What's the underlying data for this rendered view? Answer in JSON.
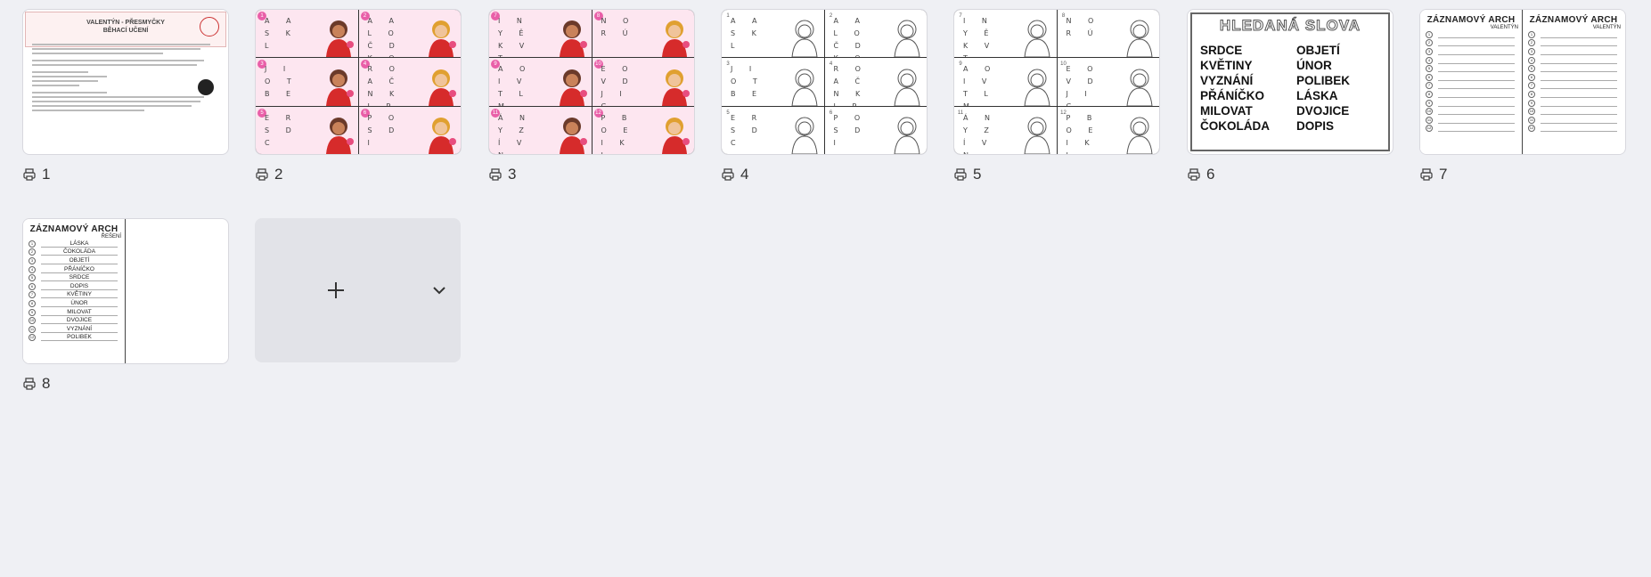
{
  "pages": [
    {
      "number": "1"
    },
    {
      "number": "2"
    },
    {
      "number": "3"
    },
    {
      "number": "4"
    },
    {
      "number": "5"
    },
    {
      "number": "6"
    },
    {
      "number": "7"
    },
    {
      "number": "8"
    }
  ],
  "page1": {
    "title_line1": "VALENTÝN - PŘESMYČKY",
    "title_line2": "BĚHACÍ UČENÍ"
  },
  "page2_cards": [
    {
      "num": "1",
      "letters": "A A S K L"
    },
    {
      "num": "2",
      "letters": "A A L O Č D K O"
    },
    {
      "num": "3",
      "letters": "J I O T B E"
    },
    {
      "num": "4",
      "letters": "R O A Č N K I P"
    },
    {
      "num": "5",
      "letters": "E R S D C"
    },
    {
      "num": "6",
      "letters": "P O S D I"
    }
  ],
  "page3_cards": [
    {
      "num": "7",
      "letters": "I N Y Ě K V T"
    },
    {
      "num": "8",
      "letters": "N O R Ú"
    },
    {
      "num": "9",
      "letters": "A O I V T L M"
    },
    {
      "num": "10",
      "letters": "E O V D J I C"
    },
    {
      "num": "11",
      "letters": "Á N Y Z Í V N"
    },
    {
      "num": "12",
      "letters": "P B O E I K L"
    }
  ],
  "page4_cards": [
    {
      "num": "1",
      "letters": "A A S K L"
    },
    {
      "num": "2",
      "letters": "A A L O Č D K O"
    },
    {
      "num": "3",
      "letters": "J I O T B E"
    },
    {
      "num": "4",
      "letters": "R O A Č N K I P"
    },
    {
      "num": "5",
      "letters": "E R S D C"
    },
    {
      "num": "6",
      "letters": "P O S D I"
    }
  ],
  "page5_cards": [
    {
      "num": "7",
      "letters": "I N Y Ě K V T"
    },
    {
      "num": "8",
      "letters": "N O R Ú"
    },
    {
      "num": "9",
      "letters": "A O I V T L M"
    },
    {
      "num": "10",
      "letters": "E O V D J I C"
    },
    {
      "num": "11",
      "letters": "Á N Y Z Í V N"
    },
    {
      "num": "12",
      "letters": "P B O E I K L"
    }
  ],
  "page6": {
    "title": "HLEDANÁ SLOVA",
    "words": [
      "SRDCE",
      "OBJETÍ",
      "KVĚTINY",
      "ÚNOR",
      "VYZNÁNÍ",
      "POLIBEK",
      "PŘÁNÍČKO",
      "LÁSKA",
      "MILOVAT",
      "DVOJICE",
      "ČOKOLÁDA",
      "DOPIS"
    ]
  },
  "page7": {
    "title": "ZÁZNAMOVÝ ARCH",
    "subtitle": "VALENTÝN"
  },
  "page8": {
    "title": "ZÁZNAMOVÝ ARCH",
    "subtitle": "ŘEŠENÍ",
    "answers": [
      "LÁSKA",
      "ČOKOLÁDA",
      "OBJETÍ",
      "PŘÁNÍČKO",
      "SRDCE",
      "DOPIS",
      "KVĚTINY",
      "ÚNOR",
      "MILOVAT",
      "DVOJICE",
      "VYZNÁNÍ",
      "POLIBEK"
    ]
  },
  "colors": {
    "background": "#eff0f4",
    "accent_pink": "#e95fa8"
  },
  "icons": {
    "page_label": "printer-icon",
    "add": "plus-icon",
    "menu": "chevron-down-icon"
  }
}
